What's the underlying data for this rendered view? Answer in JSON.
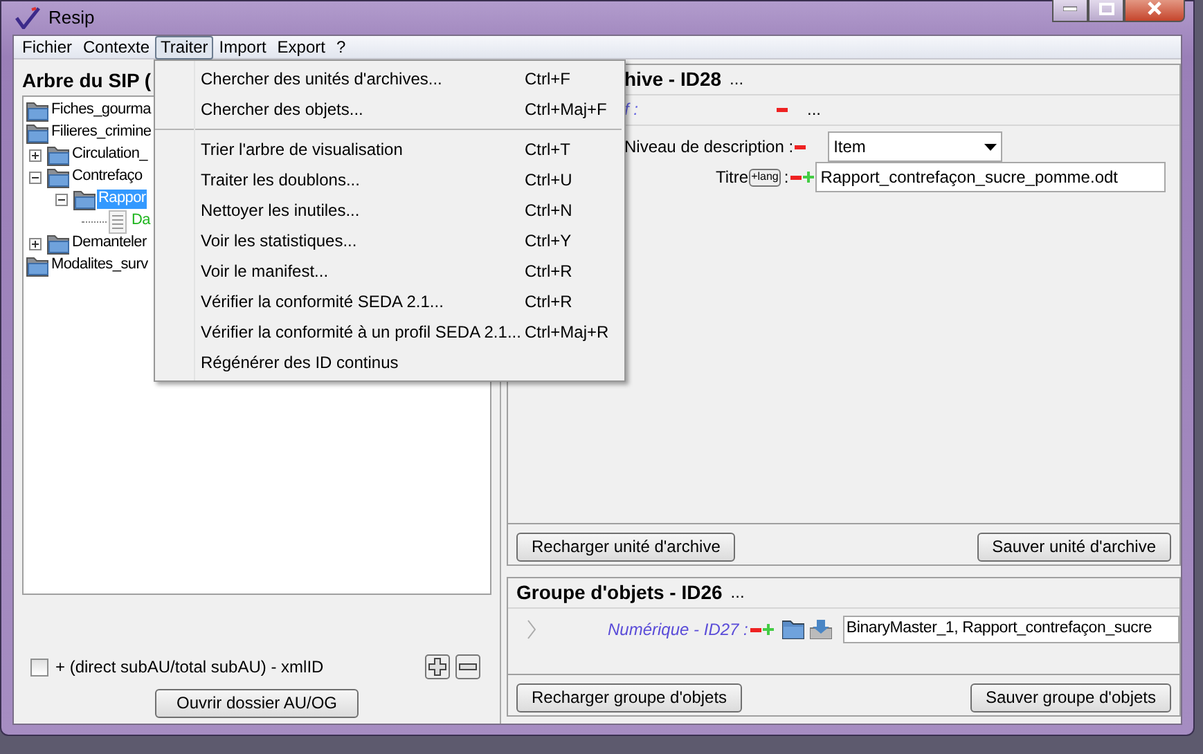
{
  "window": {
    "title": "Resip"
  },
  "menu_bar": [
    {
      "label": "Fichier",
      "selected": false
    },
    {
      "label": "Contexte",
      "selected": false
    },
    {
      "label": "Traiter",
      "selected": true
    },
    {
      "label": "Import",
      "selected": false
    },
    {
      "label": "Export",
      "selected": false
    },
    {
      "label": "?",
      "selected": false
    }
  ],
  "open_menu": {
    "items": [
      {
        "kind": "item",
        "label": "Chercher des unités d'archives...",
        "shortcut": "Ctrl+F"
      },
      {
        "kind": "item",
        "label": "Chercher des objets...",
        "shortcut": "Ctrl+Maj+F"
      },
      {
        "kind": "separator"
      },
      {
        "kind": "item",
        "label": "Trier l'arbre de visualisation",
        "shortcut": "Ctrl+T"
      },
      {
        "kind": "item",
        "label": "Traiter les doublons...",
        "shortcut": "Ctrl+U"
      },
      {
        "kind": "item",
        "label": "Nettoyer les inutiles...",
        "shortcut": "Ctrl+N"
      },
      {
        "kind": "item",
        "label": "Voir les statistiques...",
        "shortcut": "Ctrl+Y"
      },
      {
        "kind": "item",
        "label": "Voir le manifest...",
        "shortcut": "Ctrl+R"
      },
      {
        "kind": "item",
        "label": "Vérifier la conformité SEDA 2.1...",
        "shortcut": "Ctrl+R"
      },
      {
        "kind": "item",
        "label": "Vérifier la conformité à un profil SEDA 2.1...",
        "shortcut": "Ctrl+Maj+R"
      },
      {
        "kind": "item",
        "label": "Régénérer des ID continus"
      }
    ]
  },
  "left_panel": {
    "title": "Arbre du SIP (",
    "tree": [
      {
        "kind": "folder",
        "label": "Fiches_gourma",
        "selected": false
      },
      {
        "kind": "folder",
        "label": "Filieres_crimine",
        "selected": false,
        "children": [
          {
            "kind": "folder",
            "label": "Circulation_",
            "selected": false,
            "expanded": false
          },
          {
            "kind": "folder",
            "label": "Contrefaço",
            "selected": false,
            "expanded": true,
            "children": [
              {
                "kind": "folder",
                "label": "Rappor",
                "selected": true,
                "expanded": true,
                "children": [
                  {
                    "kind": "file",
                    "label": "Da",
                    "selected": false
                  }
                ]
              }
            ]
          },
          {
            "kind": "folder",
            "label": "Demanteler",
            "selected": false,
            "expanded": false
          }
        ]
      },
      {
        "kind": "folder",
        "label": "Modalites_surv",
        "selected": false
      }
    ],
    "option": {
      "label": "+ (direct subAU/total subAU) - xmlID",
      "checked": false
    },
    "button": "Ouvrir dossier AU/OG"
  },
  "archive_unit_panel": {
    "title": "hive - ID28",
    "title_more": "...",
    "metadata_row": {
      "label": "f :",
      "more": "..."
    },
    "description_level": {
      "label": "Niveau de description :",
      "value": "Item"
    },
    "title_field": {
      "label": "Titre",
      "lang_button": "+lang",
      "separator": ":",
      "value": "Rapport_contrefaçon_sucre_pomme.odt"
    },
    "buttons": [
      "Recharger unité d'archive",
      "Sauver unité d'archive"
    ]
  },
  "object_group_panel": {
    "title": "Groupe d'objets - ID26",
    "title_more": "...",
    "object_row": {
      "label": "Numérique - ID27 :",
      "value": "BinaryMaster_1, Rapport_contrefaçon_sucre"
    },
    "buttons": [
      "Recharger groupe d'objets",
      "Sauver groupe d'objets"
    ]
  }
}
